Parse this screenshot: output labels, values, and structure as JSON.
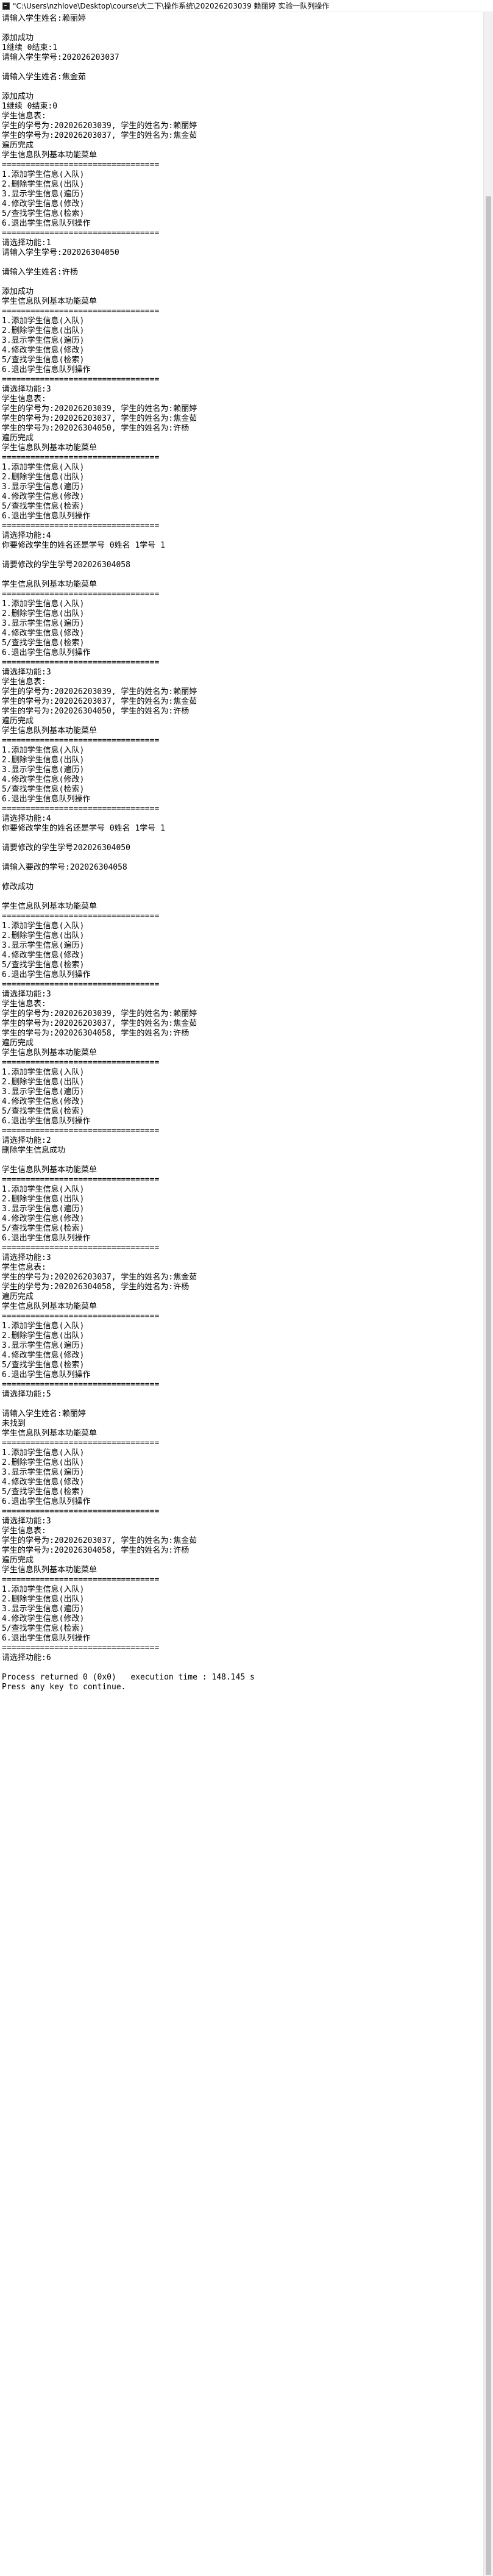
{
  "window": {
    "title": "\"C:\\Users\\nzhlove\\Desktop\\course\\大二下\\操作系统\\202026203039 赖丽婷 实验一队列操作"
  },
  "console": {
    "output": "请输入学生姓名:赖丽婷\n\n添加成功\n1继续 0结束:1\n请输入学生学号:202026203037\n\n请输入学生姓名:焦金茹\n\n添加成功\n1继续 0结束:0\n学生信息表:\n学生的学号为:202026203039, 学生的姓名为:赖丽婷\n学生的学号为:202026203037, 学生的姓名为:焦金茹\n遍历完成\n学生信息队列基本功能菜单\n=================================\n1.添加学生信息(入队)\n2.删除学生信息(出队)\n3.显示学生信息(遍历)\n4.修改学生信息(修改)\n5/查找学生信息(检索)\n6.退出学生信息队列操作\n=================================\n请选择功能:1\n请输入学生学号:202026304050\n\n请输入学生姓名:许杨\n\n添加成功\n学生信息队列基本功能菜单\n=================================\n1.添加学生信息(入队)\n2.删除学生信息(出队)\n3.显示学生信息(遍历)\n4.修改学生信息(修改)\n5/查找学生信息(检索)\n6.退出学生信息队列操作\n=================================\n请选择功能:3\n学生信息表:\n学生的学号为:202026203039, 学生的姓名为:赖丽婷\n学生的学号为:202026203037, 学生的姓名为:焦金茹\n学生的学号为:202026304050, 学生的姓名为:许杨\n遍历完成\n学生信息队列基本功能菜单\n=================================\n1.添加学生信息(入队)\n2.删除学生信息(出队)\n3.显示学生信息(遍历)\n4.修改学生信息(修改)\n5/查找学生信息(检索)\n6.退出学生信息队列操作\n=================================\n请选择功能:4\n你要修改学生的姓名还是学号 0姓名 1学号 1\n\n请要修改的学生学号202026304058\n\n学生信息队列基本功能菜单\n=================================\n1.添加学生信息(入队)\n2.删除学生信息(出队)\n3.显示学生信息(遍历)\n4.修改学生信息(修改)\n5/查找学生信息(检索)\n6.退出学生信息队列操作\n=================================\n请选择功能:3\n学生信息表:\n学生的学号为:202026203039, 学生的姓名为:赖丽婷\n学生的学号为:202026203037, 学生的姓名为:焦金茹\n学生的学号为:202026304050, 学生的姓名为:许杨\n遍历完成\n学生信息队列基本功能菜单\n=================================\n1.添加学生信息(入队)\n2.删除学生信息(出队)\n3.显示学生信息(遍历)\n4.修改学生信息(修改)\n5/查找学生信息(检索)\n6.退出学生信息队列操作\n=================================\n请选择功能:4\n你要修改学生的姓名还是学号 0姓名 1学号 1\n\n请要修改的学生学号202026304050\n\n请输入要改的学号:202026304058\n\n修改成功\n\n学生信息队列基本功能菜单\n=================================\n1.添加学生信息(入队)\n2.删除学生信息(出队)\n3.显示学生信息(遍历)\n4.修改学生信息(修改)\n5/查找学生信息(检索)\n6.退出学生信息队列操作\n=================================\n请选择功能:3\n学生信息表:\n学生的学号为:202026203039, 学生的姓名为:赖丽婷\n学生的学号为:202026203037, 学生的姓名为:焦金茹\n学生的学号为:202026304058, 学生的姓名为:许杨\n遍历完成\n学生信息队列基本功能菜单\n=================================\n1.添加学生信息(入队)\n2.删除学生信息(出队)\n3.显示学生信息(遍历)\n4.修改学生信息(修改)\n5/查找学生信息(检索)\n6.退出学生信息队列操作\n=================================\n请选择功能:2\n删除学生信息成功\n\n学生信息队列基本功能菜单\n=================================\n1.添加学生信息(入队)\n2.删除学生信息(出队)\n3.显示学生信息(遍历)\n4.修改学生信息(修改)\n5/查找学生信息(检索)\n6.退出学生信息队列操作\n=================================\n请选择功能:3\n学生信息表:\n学生的学号为:202026203037, 学生的姓名为:焦金茹\n学生的学号为:202026304058, 学生的姓名为:许杨\n遍历完成\n学生信息队列基本功能菜单\n=================================\n1.添加学生信息(入队)\n2.删除学生信息(出队)\n3.显示学生信息(遍历)\n4.修改学生信息(修改)\n5/查找学生信息(检索)\n6.退出学生信息队列操作\n=================================\n请选择功能:5\n\n请输入学生姓名:赖丽婷\n未找到\n学生信息队列基本功能菜单\n=================================\n1.添加学生信息(入队)\n2.删除学生信息(出队)\n3.显示学生信息(遍历)\n4.修改学生信息(修改)\n5/查找学生信息(检索)\n6.退出学生信息队列操作\n=================================\n请选择功能:3\n学生信息表:\n学生的学号为:202026203037, 学生的姓名为:焦金茹\n学生的学号为:202026304058, 学生的姓名为:许杨\n遍历完成\n学生信息队列基本功能菜单\n=================================\n1.添加学生信息(入队)\n2.删除学生信息(出队)\n3.显示学生信息(遍历)\n4.修改学生信息(修改)\n5/查找学生信息(检索)\n6.退出学生信息队列操作\n=================================\n请选择功能:6\n\nProcess returned 0 (0x0)   execution time : 148.145 s\nPress any key to continue."
  }
}
